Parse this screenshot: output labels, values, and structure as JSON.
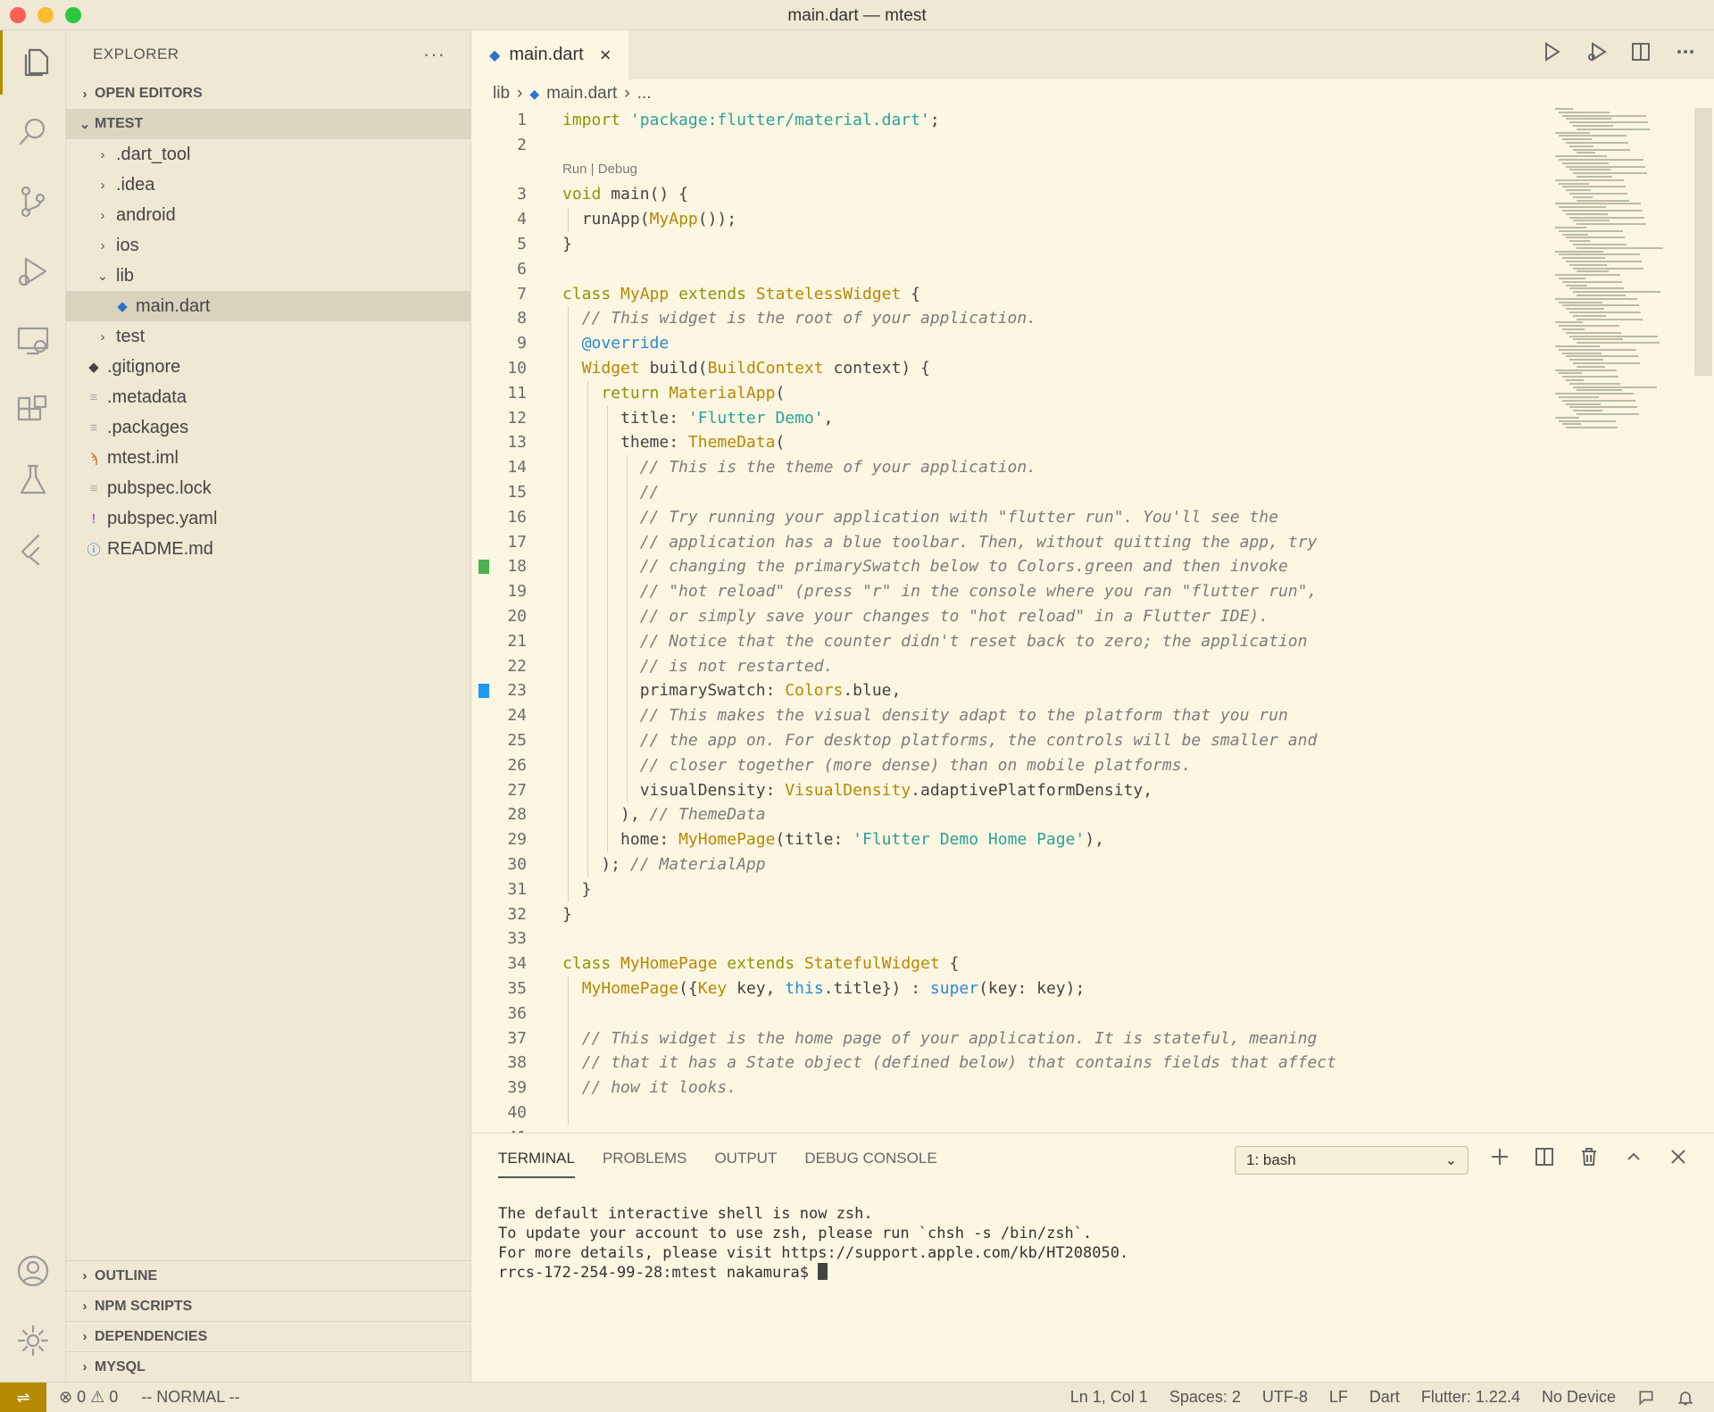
{
  "window": {
    "title": "main.dart — mtest"
  },
  "explorer": {
    "header": "EXPLORER",
    "more": "···",
    "open_editors": "OPEN EDITORS",
    "workspace": "MTEST",
    "items": [
      {
        "label": ".dart_tool",
        "kind": "folder-closed"
      },
      {
        "label": ".idea",
        "kind": "folder-closed"
      },
      {
        "label": "android",
        "kind": "folder-closed"
      },
      {
        "label": "ios",
        "kind": "folder-closed"
      },
      {
        "label": "lib",
        "kind": "folder-open"
      },
      {
        "label": "main.dart",
        "kind": "dart-file"
      },
      {
        "label": "test",
        "kind": "folder-closed"
      },
      {
        "label": ".gitignore",
        "kind": "git-file"
      },
      {
        "label": ".metadata",
        "kind": "text-file"
      },
      {
        "label": ".packages",
        "kind": "text-file"
      },
      {
        "label": "mtest.iml",
        "kind": "rss-file"
      },
      {
        "label": "pubspec.lock",
        "kind": "text-file"
      },
      {
        "label": "pubspec.yaml",
        "kind": "yaml-file"
      },
      {
        "label": "README.md",
        "kind": "info-file"
      }
    ],
    "bottom_sections": [
      "OUTLINE",
      "NPM SCRIPTS",
      "DEPENDENCIES",
      "MYSQL"
    ]
  },
  "tab": {
    "label": "main.dart",
    "close": "×"
  },
  "breadcrumb": {
    "folder": "lib",
    "file": "main.dart",
    "more": "..."
  },
  "codelens": "Run | Debug",
  "code_lines": [
    "import 'package:flutter/material.dart';",
    "",
    "void main() {",
    "  runApp(MyApp());",
    "}",
    "",
    "class MyApp extends StatelessWidget {",
    "  // This widget is the root of your application.",
    "  @override",
    "  Widget build(BuildContext context) {",
    "    return MaterialApp(",
    "      title: 'Flutter Demo',",
    "      theme: ThemeData(",
    "        // This is the theme of your application.",
    "        //",
    "        // Try running your application with \"flutter run\". You'll see the",
    "        // application has a blue toolbar. Then, without quitting the app, try",
    "        // changing the primarySwatch below to Colors.green and then invoke",
    "        // \"hot reload\" (press \"r\" in the console where you ran \"flutter run\",",
    "        // or simply save your changes to \"hot reload\" in a Flutter IDE).",
    "        // Notice that the counter didn't reset back to zero; the application",
    "        // is not restarted.",
    "        primarySwatch: Colors.blue,",
    "        // This makes the visual density adapt to the platform that you run",
    "        // the app on. For desktop platforms, the controls will be smaller and",
    "        // closer together (more dense) than on mobile platforms.",
    "        visualDensity: VisualDensity.adaptivePlatformDensity,",
    "      ), // ThemeData",
    "      home: MyHomePage(title: 'Flutter Demo Home Page'),",
    "    ); // MaterialApp",
    "  }",
    "}",
    "",
    "class MyHomePage extends StatefulWidget {",
    "  MyHomePage({Key key, this.title}) : super(key: key);",
    "",
    "  // This widget is the home page of your application. It is stateful, meaning",
    "  // that it has a State object (defined below) that contains fields that affect",
    "  // how it looks.",
    ""
  ],
  "gutter_marks": [
    {
      "line": 18,
      "color": "#4caf50"
    },
    {
      "line": 23,
      "color": "#2196f3"
    }
  ],
  "panel": {
    "tabs": [
      "TERMINAL",
      "PROBLEMS",
      "OUTPUT",
      "DEBUG CONSOLE"
    ],
    "active_tab": "TERMINAL",
    "terminal_select": "1: bash",
    "terminal_lines": [
      "The default interactive shell is now zsh.",
      "To update your account to use zsh, please run `chsh -s /bin/zsh`.",
      "For more details, please visit https://support.apple.com/kb/HT208050.",
      "rrcs-172-254-99-28:mtest nakamura$ "
    ]
  },
  "status": {
    "errors": "0",
    "warnings": "0",
    "mode": "-- NORMAL --",
    "position": "Ln 1, Col 1",
    "spaces": "Spaces: 2",
    "encoding": "UTF-8",
    "eol": "LF",
    "language": "Dart",
    "flutter": "Flutter: 1.22.4",
    "device": "No Device"
  },
  "colors": {
    "accent": "#b58900",
    "background": "#fdf6e3",
    "sidebar": "#eee8d5"
  }
}
